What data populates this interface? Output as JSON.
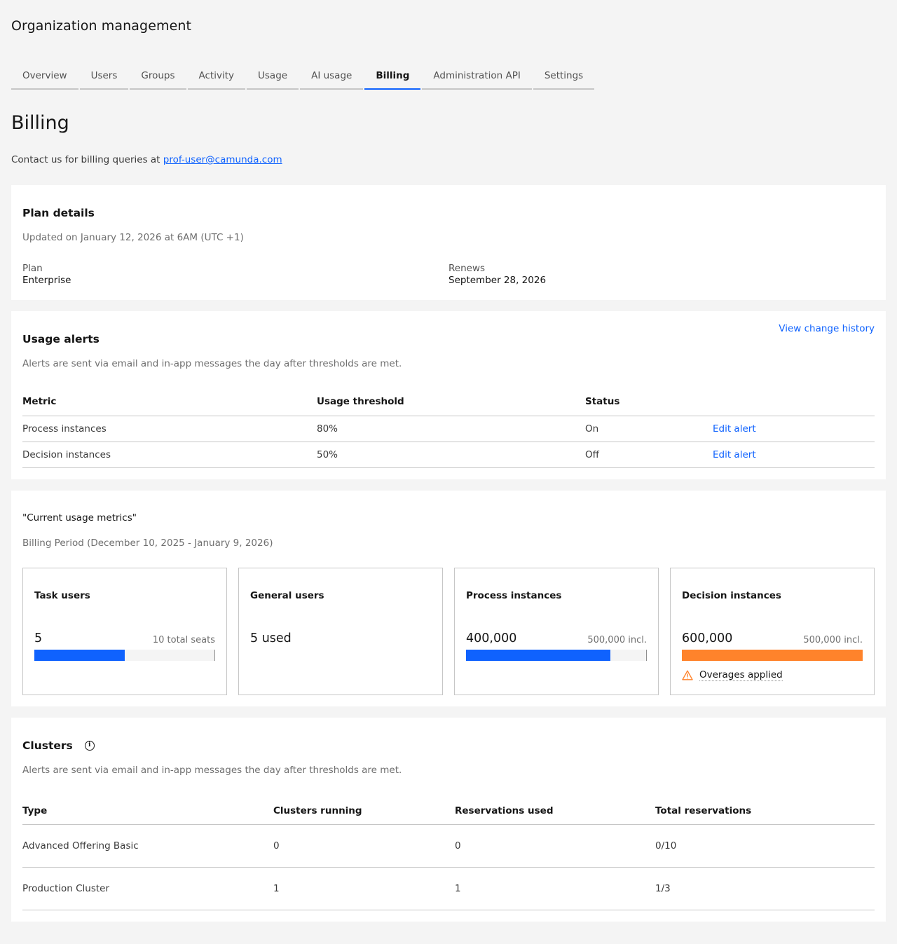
{
  "app": {
    "title": "Organization management"
  },
  "tabs": [
    {
      "label": "Overview"
    },
    {
      "label": "Users"
    },
    {
      "label": "Groups"
    },
    {
      "label": "Activity"
    },
    {
      "label": "Usage"
    },
    {
      "label": "AI usage"
    },
    {
      "label": "Billing",
      "active": true
    },
    {
      "label": "Administration API"
    },
    {
      "label": "Settings"
    }
  ],
  "page": {
    "title": "Billing",
    "contact_text": "Contact us for billing queries at ",
    "contact_email": "prof-user@camunda.com"
  },
  "plan": {
    "title": "Plan details",
    "updated": "Updated on January 12, 2026 at 6AM (UTC +1)",
    "plan_label": "Plan",
    "plan_value": "Enterprise",
    "renews_label": "Renews",
    "renews_value": "September 28, 2026"
  },
  "alerts": {
    "title": "Usage alerts",
    "history_link": "View change history",
    "subtitle": "Alerts are sent via email and in-app messages the day after thresholds are met.",
    "headers": [
      "Metric",
      "Usage threshold",
      "Status"
    ],
    "rows": [
      {
        "metric": "Process instances",
        "threshold": "80%",
        "status": "On",
        "action": "Edit alert"
      },
      {
        "metric": "Decision instances",
        "threshold": "50%",
        "status": "Off",
        "action": "Edit alert"
      }
    ]
  },
  "metrics": {
    "title": "\"Current usage metrics\"",
    "period": "Billing Period (December 10, 2025 - January 9, 2026)",
    "tiles": [
      {
        "title": "Task users",
        "value": "5",
        "limit": "10 total seats",
        "fill": 0.5,
        "color": "#0f62fe"
      },
      {
        "title": "General users",
        "value": "5 used"
      },
      {
        "title": "Process instances",
        "value": "400,000",
        "limit": "500,000 incl.",
        "fill": 0.8,
        "color": "#0f62fe"
      },
      {
        "title": "Decision instances",
        "value": "600,000",
        "limit": "500,000 incl.",
        "fill": 1.0,
        "color": "#ff832b",
        "warning": "Overages applied"
      }
    ]
  },
  "clusters": {
    "title": "Clusters",
    "info_icon": "i",
    "subtitle": "Alerts are sent via email and in-app messages the day after thresholds are met.",
    "headers": [
      "Type",
      "Clusters running",
      "Reservations used",
      "Total reservations"
    ],
    "rows": [
      {
        "type": "Advanced Offering Basic",
        "running": "0",
        "used": "0",
        "total": "0/10"
      },
      {
        "type": "Production Cluster",
        "running": "1",
        "used": "1",
        "total": "1/3"
      }
    ]
  }
}
